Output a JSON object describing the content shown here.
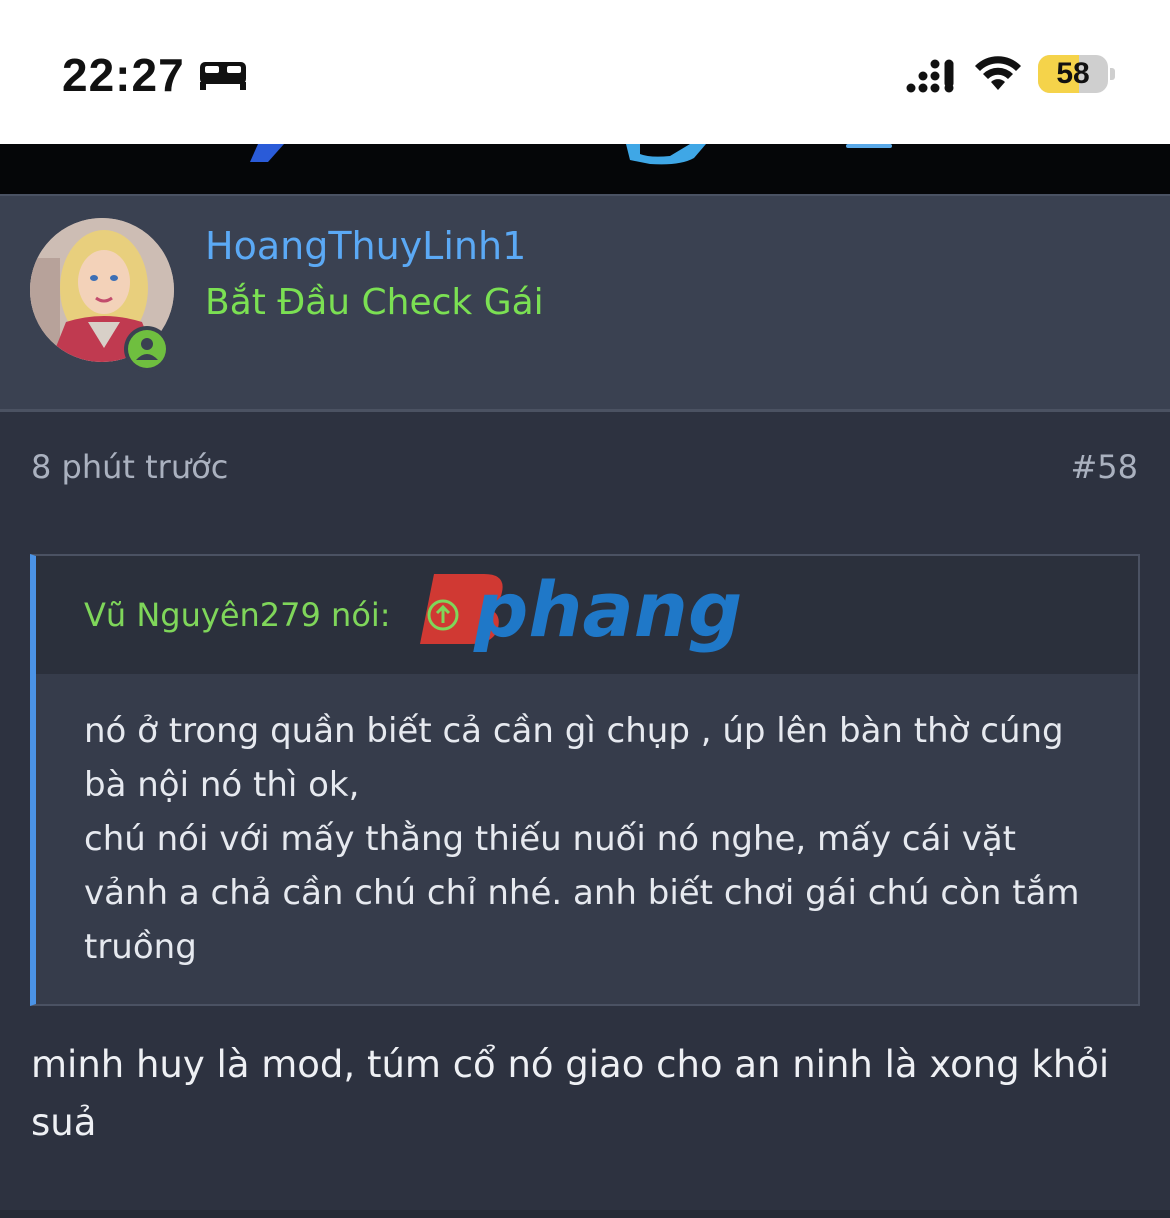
{
  "status_bar": {
    "time": "22:27",
    "battery_level": "58",
    "battery_fraction": 0.58,
    "icons": [
      "bed-icon",
      "cellular-signal-icon",
      "wifi-icon",
      "battery-icon"
    ]
  },
  "user": {
    "name": "HoangThuyLinh1",
    "title": "Bắt Đầu Check Gái",
    "avatar": "avatar",
    "online_badge_icon": "user-online-icon"
  },
  "post": {
    "time": "8 phút trước",
    "number": "#58",
    "quote": {
      "author": "Vũ Nguyên279 nói:",
      "jump_icon": "arrow-up-circle-icon",
      "body": "nó ở trong quần biết cả cần gì chụp , úp lên bàn thờ cúng bà nội nó thì ok,\nchú nói với mấy thằng thiếu nuối nó nghe, mấy cái vặt vảnh a chả cần chú chỉ nhé. anh biết chơi gái chú còn tắm truồng"
    },
    "body": "minh huy là mod, túm cổ nó giao cho an ninh là xong khỏi suả"
  },
  "watermark": "phang",
  "colors": {
    "username": "#5ba9f5",
    "user_title": "#7be053",
    "quote_author": "#7fd65a",
    "quote_border": "#4b93e6",
    "background": "#2d3240",
    "header_bg": "#3a4151",
    "battery": "#f5d34a"
  }
}
